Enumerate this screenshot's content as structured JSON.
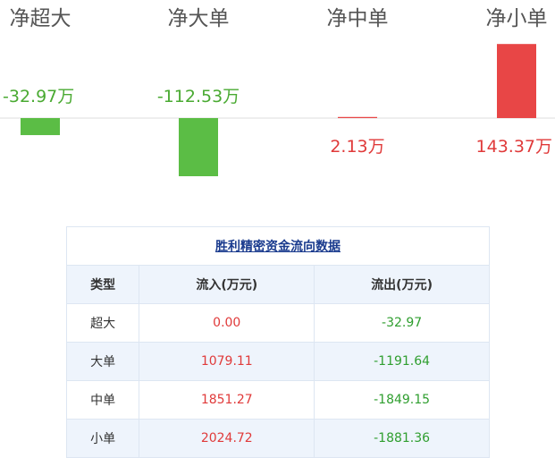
{
  "colors": {
    "positive": "#e84646",
    "negative": "#5bbd45",
    "positive_text": "#e03a3a",
    "negative_text": "#4aaa32"
  },
  "chart_data": {
    "type": "bar",
    "categories": [
      "净超大",
      "净大单",
      "净中单",
      "净小单"
    ],
    "values": [
      -32.97,
      -112.53,
      2.13,
      143.37
    ],
    "value_labels": [
      "-32.97万",
      "-112.53万",
      "2.13万",
      "143.37万"
    ],
    "unit": "万",
    "ylim": [
      -112.53,
      143.37
    ],
    "grid": false
  },
  "table": {
    "title": "胜利精密资金流向数据",
    "headers": [
      "类型",
      "流入(万元)",
      "流出(万元)"
    ],
    "rows": [
      {
        "type": "超大",
        "in": "0.00",
        "out": "-32.97"
      },
      {
        "type": "大单",
        "in": "1079.11",
        "out": "-1191.64"
      },
      {
        "type": "中单",
        "in": "1851.27",
        "out": "-1849.15"
      },
      {
        "type": "小单",
        "in": "2024.72",
        "out": "-1881.36"
      }
    ]
  }
}
